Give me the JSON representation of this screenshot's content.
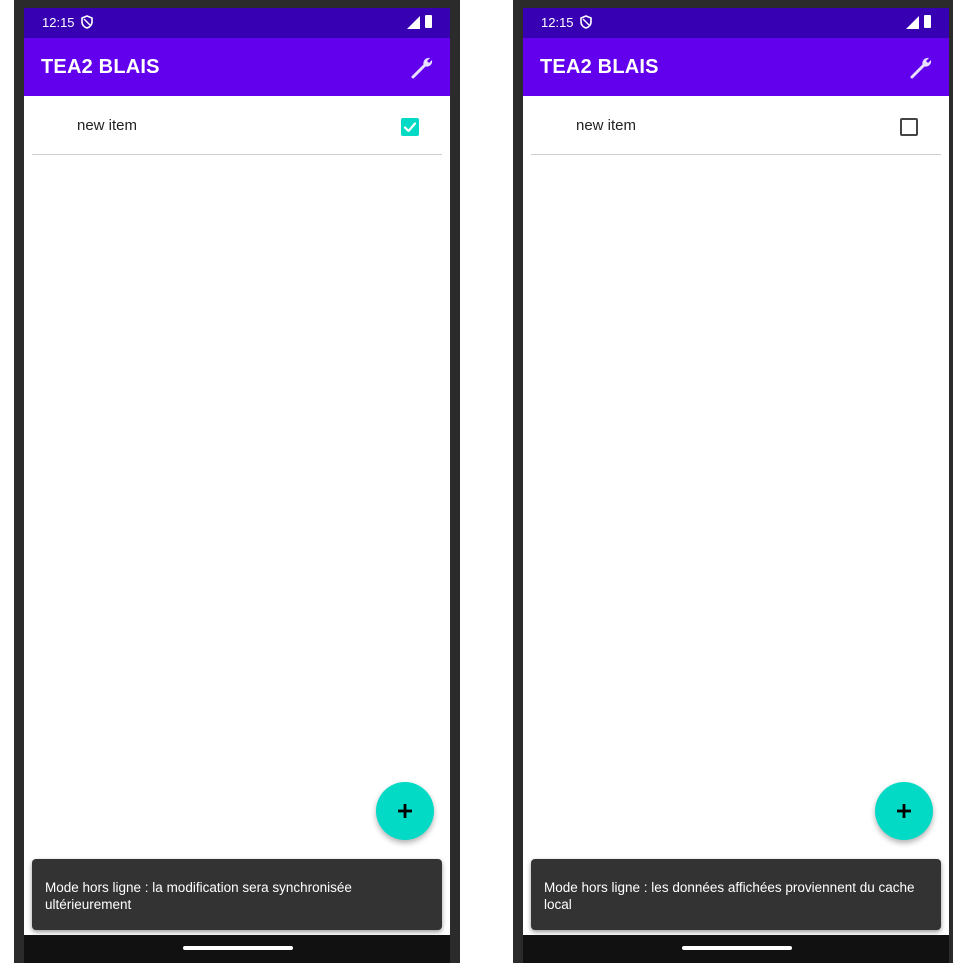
{
  "screens": [
    {
      "status_time": "12:15",
      "app_title": "TEA2 BLAIS",
      "item_label": "new item",
      "item_checked": true,
      "snackbar_message": "Mode hors ligne : la modification sera synchronisée ultérieurement"
    },
    {
      "status_time": "12:15",
      "app_title": "TEA2 BLAIS",
      "item_label": "new item",
      "item_checked": false,
      "snackbar_message": "Mode hors ligne : les données affichées proviennent du cache local"
    }
  ],
  "colors": {
    "status_bar": "#3700b3",
    "app_bar": "#6200ee",
    "accent": "#03dac5",
    "snackbar": "#333333"
  },
  "icons": {
    "status": [
      "shield-icon",
      "signal-icon",
      "battery-icon"
    ],
    "toolbar": "wrench-icon",
    "fab": "plus-icon",
    "checkbox_checked": "checkmark-icon"
  }
}
